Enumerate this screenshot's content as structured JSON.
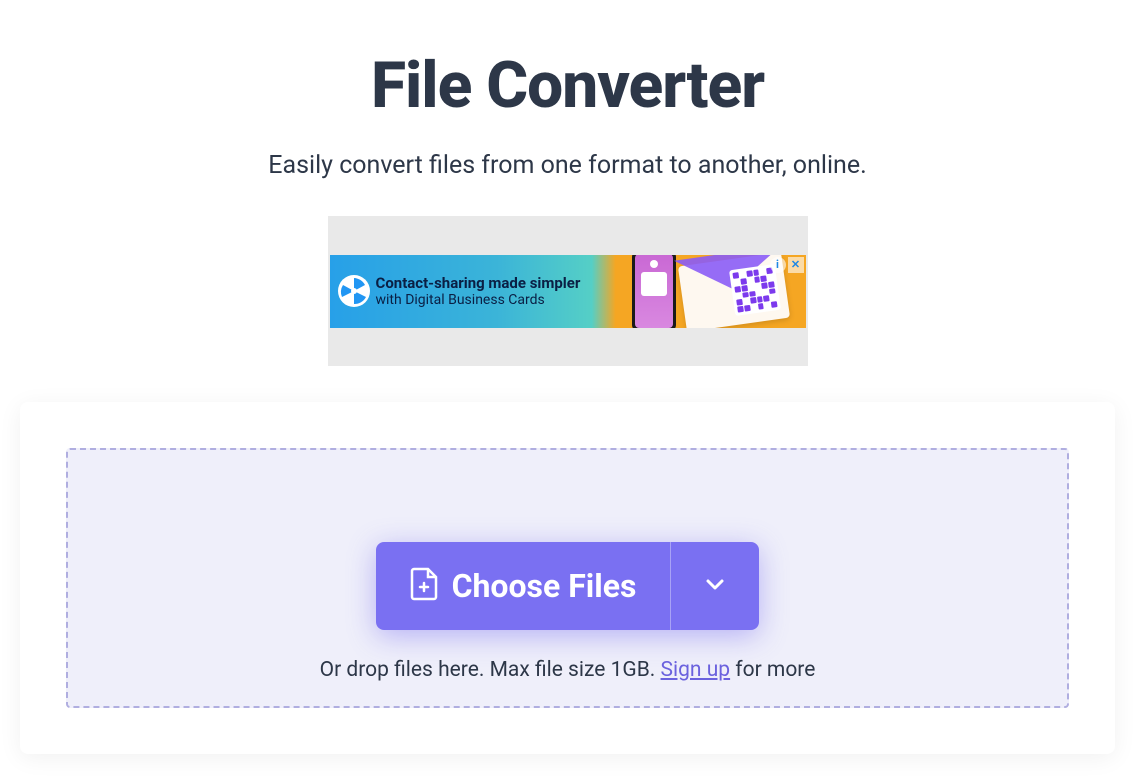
{
  "header": {
    "title": "File Converter",
    "subtitle": "Easily convert files from one format to another, online."
  },
  "ad": {
    "headline": "Contact-sharing made simpler",
    "subline": "with Digital Business Cards",
    "info_label": "i",
    "close_label": "✕"
  },
  "dropzone": {
    "choose_label": "Choose Files",
    "hint_prefix": "Or drop files here. Max file size 1GB. ",
    "signup_label": "Sign up",
    "hint_suffix": " for more"
  },
  "colors": {
    "accent": "#7a70f2",
    "text": "#2d3748",
    "dropzone_bg": "#efeffa",
    "dropzone_border": "#b0aee0"
  }
}
